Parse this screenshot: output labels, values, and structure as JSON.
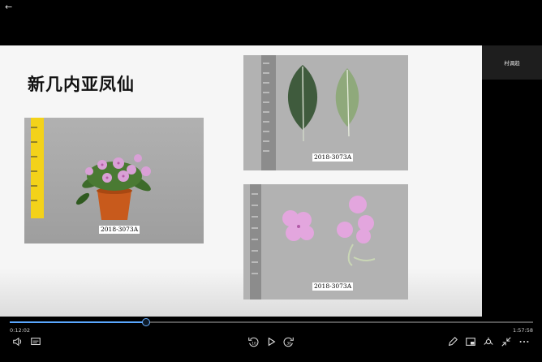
{
  "slide": {
    "title": "新几内亚凤仙",
    "captions": {
      "plant": "2018-3073A",
      "leaves": "2018-3073A",
      "flowers": "2018-3073A"
    }
  },
  "side_panel": {
    "label": "村调趋"
  },
  "player": {
    "progress": 0.26,
    "current_time": "0:12:02",
    "total_time": "1:57:58",
    "colors": {
      "accent": "#5aa7ff",
      "background": "#000000"
    },
    "icons": [
      "back-arrow-icon",
      "volume-icon",
      "subtitles-icon",
      "skip-back-10-icon",
      "play-icon",
      "skip-forward-30-icon",
      "pen-icon",
      "cast-icon",
      "collection-icon",
      "exit-fullscreen-icon",
      "more-icon"
    ]
  }
}
